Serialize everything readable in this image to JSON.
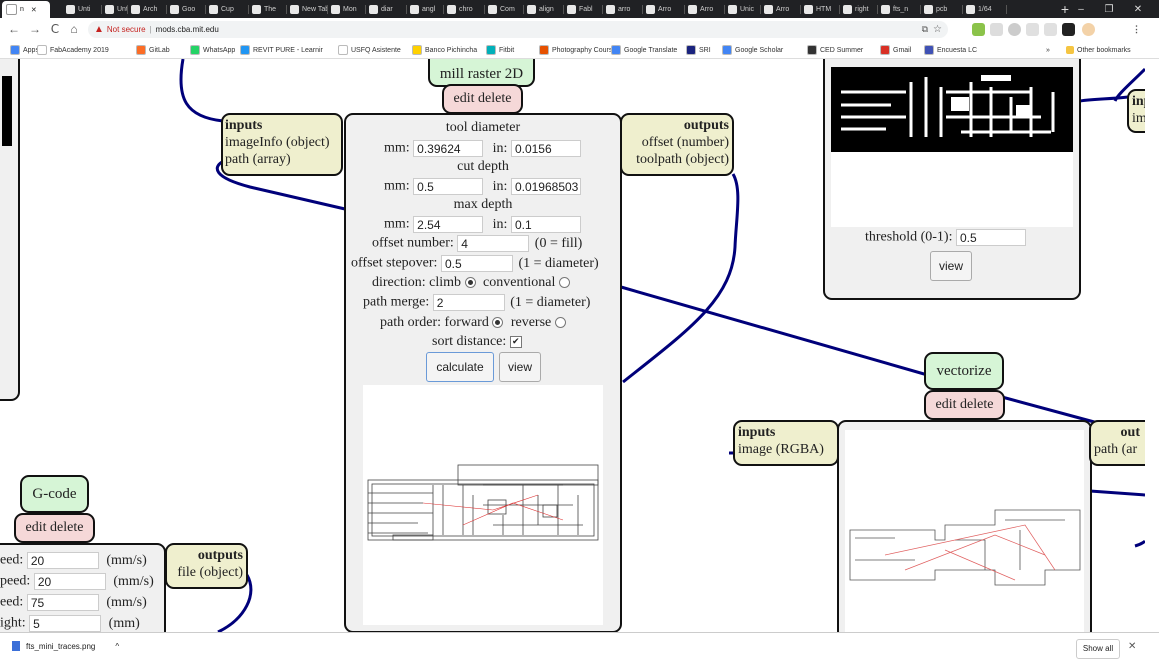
{
  "browser": {
    "active_tab": "n",
    "tabs": [
      "Unti",
      "Unti",
      "Arch",
      "Goo",
      "Cup",
      "The",
      "New Tab",
      "Mon",
      "diar",
      "angl",
      "chro",
      "Com",
      "align",
      "Fabl",
      "arro",
      "Arro",
      "Arro",
      "Unic",
      "Arro",
      "HTM",
      "right",
      "fts_n",
      "pcb",
      "1/64"
    ],
    "new_tab": "+",
    "window": {
      "minimize": "–",
      "restore": "❐",
      "close": "✕"
    },
    "nav": {
      "back": "←",
      "forward": "→",
      "reload": "C",
      "home": "⌂"
    },
    "security": "Not secure",
    "url": "mods.cba.mit.edu",
    "bookmarks": [
      "Apps",
      "FabAcademy 2019",
      "GitLab",
      "WhatsApp",
      "REVIT PURE - Learnir",
      "USFQ Asistente",
      "Banco Pichincha",
      "Fitbit",
      "Photography Courses",
      "Google Translate",
      "SRI",
      "Google Scholar",
      "CED Summer",
      "Gmail",
      "Encuesta LC"
    ],
    "bookmarks_more": "»",
    "other_bookmarks": "Other bookmarks"
  },
  "mill_module": {
    "title": "mill raster 2D",
    "edit": "edit delete",
    "inputs": {
      "header": "inputs",
      "items": [
        "imageInfo (object)",
        "path (array)"
      ]
    },
    "outputs": {
      "header": "outputs",
      "items": [
        "offset (number)",
        "toolpath (object)"
      ]
    },
    "tool_diameter": {
      "label": "tool diameter",
      "mm_label": "mm:",
      "mm": "0.39624",
      "in_label": "in:",
      "in": "0.0156"
    },
    "cut_depth": {
      "label": "cut depth",
      "mm_label": "mm:",
      "mm": "0.5",
      "in_label": "in:",
      "in": "0.01968503"
    },
    "max_depth": {
      "label": "max depth",
      "mm_label": "mm:",
      "mm": "2.54",
      "in_label": "in:",
      "in": "0.1"
    },
    "offset_number": {
      "label": "offset number:",
      "value": "4",
      "hint": "(0 = fill)"
    },
    "offset_stepover": {
      "label": "offset stepover:",
      "value": "0.5",
      "hint": "(1 = diameter)"
    },
    "direction": {
      "label": "direction: climb",
      "alt": "conventional",
      "selected": "climb"
    },
    "path_merge": {
      "label": "path merge:",
      "value": "2",
      "hint": "(1 = diameter)"
    },
    "path_order": {
      "label": "path order: forward",
      "alt": "reverse",
      "selected": "forward"
    },
    "sort_distance": {
      "label": "sort distance:",
      "checked": true,
      "mark": "✔"
    },
    "calculate": "calculate",
    "view": "view"
  },
  "image_module": {
    "threshold_label": "threshold (0-1):",
    "threshold": "0.5",
    "view": "view",
    "inputs_header": "inputs",
    "inputs_item": "im"
  },
  "vectorize_module": {
    "title": "vectorize",
    "edit": "edit delete",
    "inputs": {
      "header": "inputs",
      "items": [
        "image (RGBA)"
      ]
    },
    "outputs": {
      "header": "out",
      "items": [
        "path (ar"
      ]
    }
  },
  "gcode_module": {
    "title": "G-code",
    "edit": "edit delete",
    "rows": [
      {
        "label": "eed:",
        "value": "20",
        "unit": "(mm/s)"
      },
      {
        "label": "peed:",
        "value": "20",
        "unit": "(mm/s)"
      },
      {
        "label": "eed:",
        "value": "75",
        "unit": "(mm/s)"
      },
      {
        "label": "ight:",
        "value": "5",
        "unit": "(mm)"
      }
    ],
    "outputs": {
      "header": "outputs",
      "items": [
        "file (object)"
      ]
    }
  },
  "downloads": {
    "file": "fts_mini_traces.png",
    "chevron": "^",
    "show_all": "Show all",
    "close": "✕"
  },
  "colors": {
    "wire": "#00007a",
    "io": "#efefce",
    "title": "#d6f5d6",
    "edit": "#f5d8d8",
    "panel": "#f0f0f0"
  }
}
